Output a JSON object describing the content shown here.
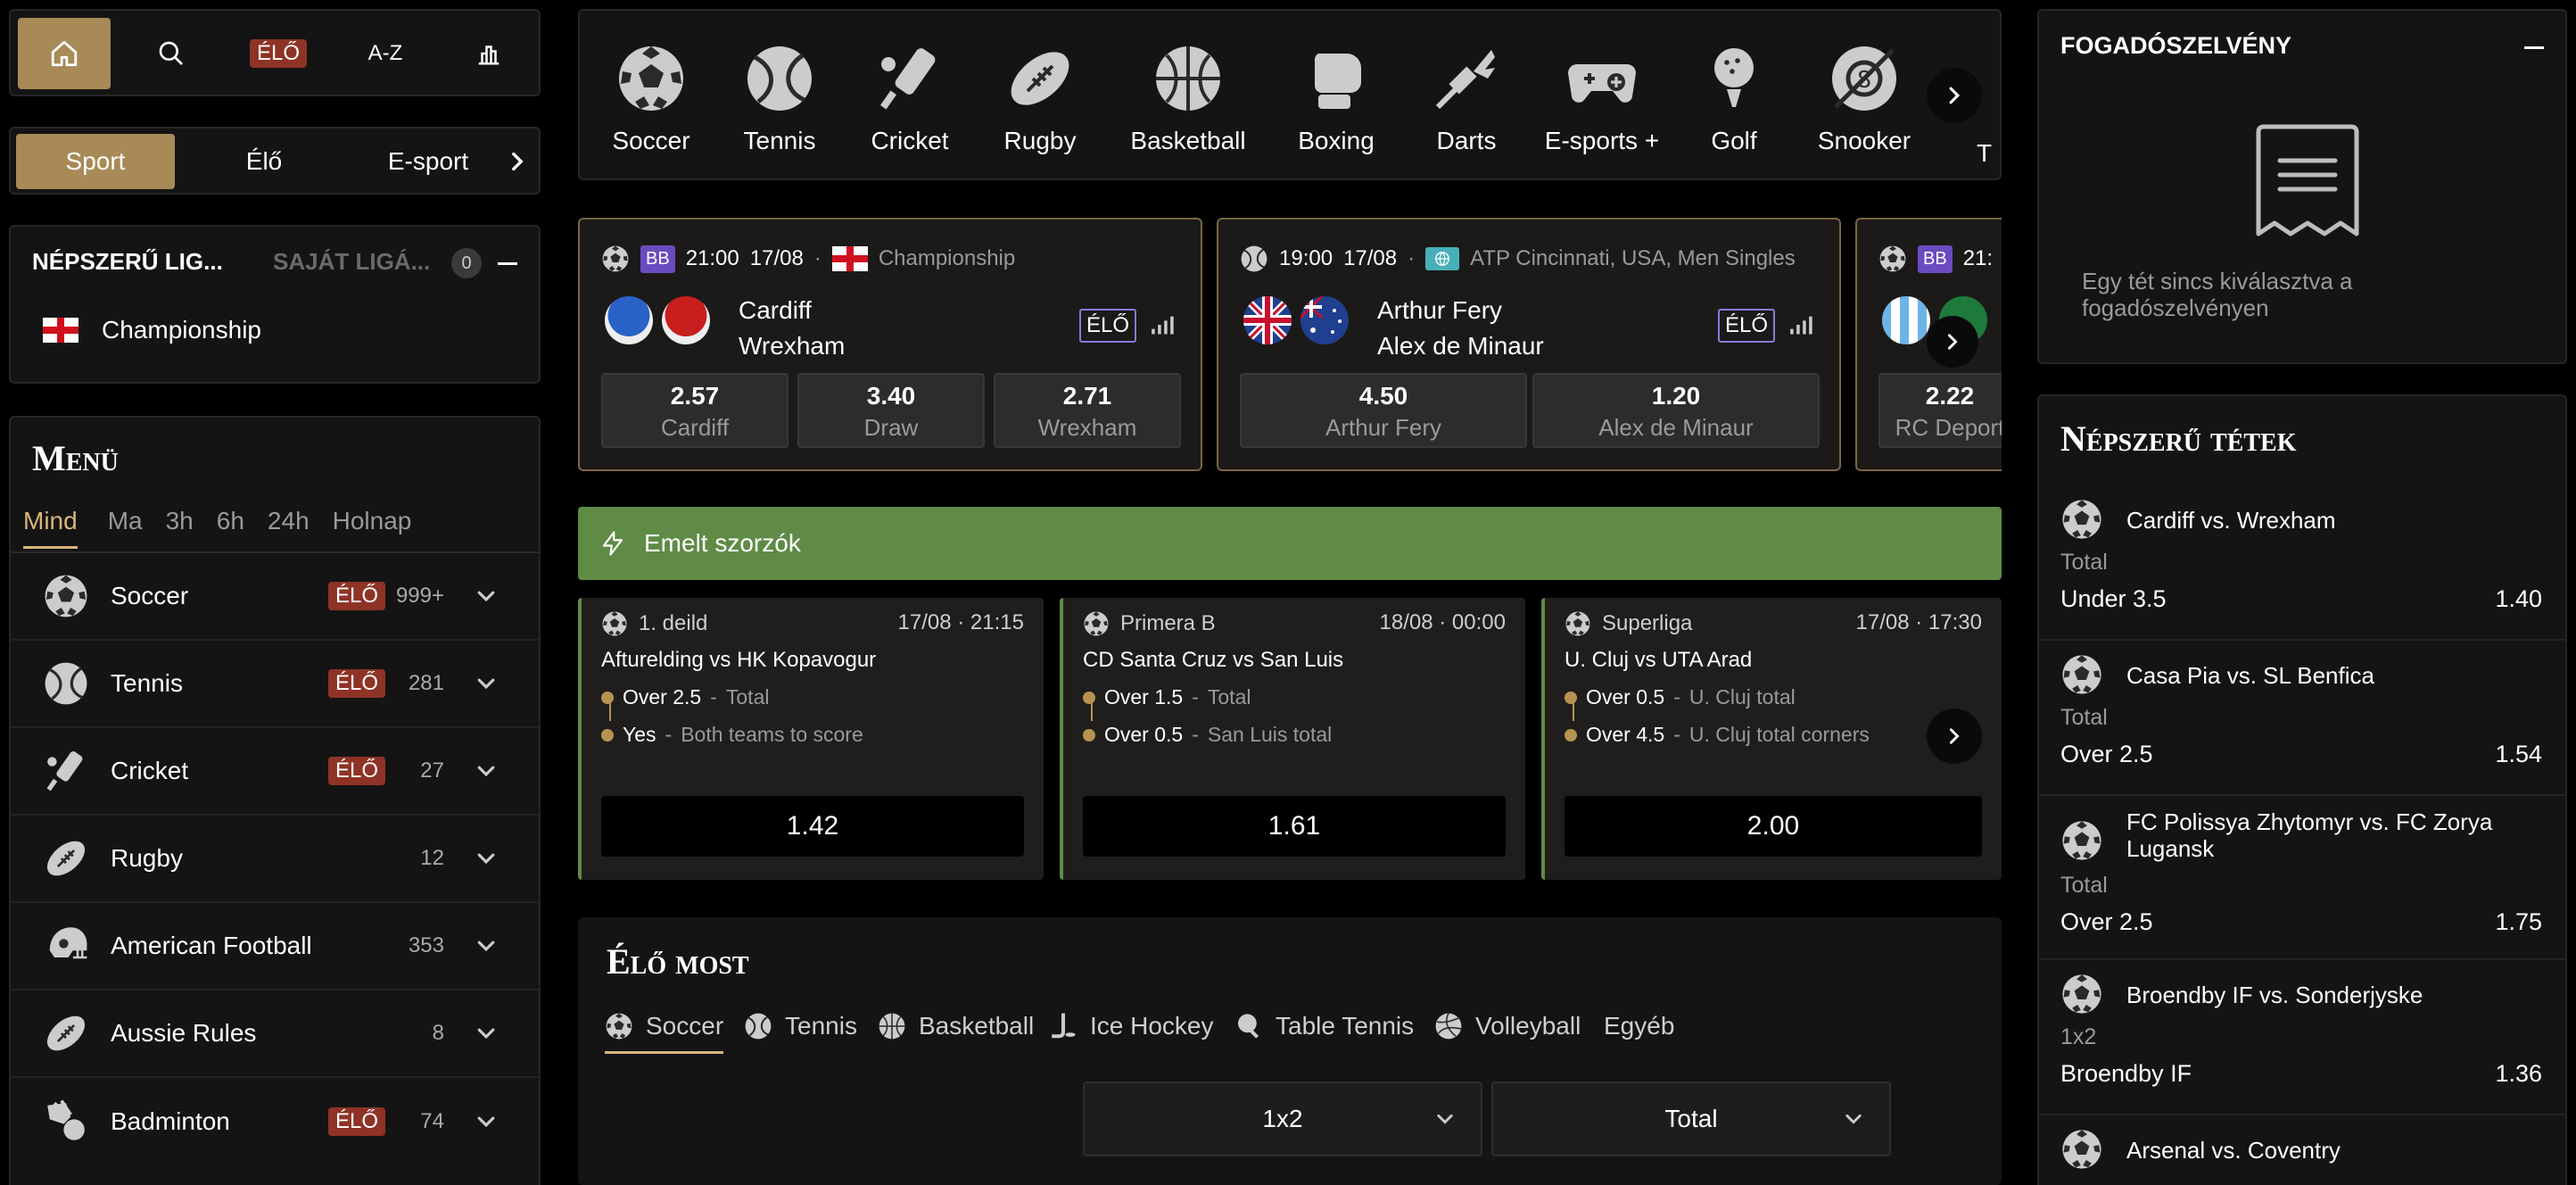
{
  "topnav": {
    "items": [
      {
        "icon": "home-icon"
      },
      {
        "icon": "search-icon"
      },
      {
        "label": "ÉLŐ"
      },
      {
        "label": "A-Z"
      },
      {
        "icon": "bar-chart-icon"
      }
    ]
  },
  "sportswitch": {
    "items": [
      "Sport",
      "Élő",
      "E-sport"
    ]
  },
  "leagues": {
    "tab_popular": "NÉPSZERŰ LIG...",
    "tab_own": "SAJÁT LIGÁ...",
    "own_count": "0",
    "items": [
      "Championship"
    ]
  },
  "menu": {
    "title": "Menü",
    "filters": [
      "Mind",
      "Ma",
      "3h",
      "6h",
      "24h",
      "Holnap"
    ],
    "live_label": "ÉLŐ",
    "items": [
      {
        "label": "Soccer",
        "live": true,
        "count": "999+"
      },
      {
        "label": "Tennis",
        "live": true,
        "count": "281"
      },
      {
        "label": "Cricket",
        "live": true,
        "count": "27"
      },
      {
        "label": "Rugby",
        "live": false,
        "count": "12"
      },
      {
        "label": "American Football",
        "live": false,
        "count": "353"
      },
      {
        "label": "Aussie Rules",
        "live": false,
        "count": "8"
      },
      {
        "label": "Badminton",
        "live": true,
        "count": "74"
      }
    ]
  },
  "sportbar": {
    "items": [
      "Soccer",
      "Tennis",
      "Cricket",
      "Rugby",
      "Basketball",
      "Boxing",
      "Darts",
      "E-sports +",
      "Golf",
      "Snooker",
      "T"
    ]
  },
  "matches": [
    {
      "bb": "BB",
      "time": "21:00",
      "date": "17/08",
      "league": "Championship",
      "home": "Cardiff",
      "away": "Wrexham",
      "live": "ÉLŐ",
      "odds": [
        {
          "v": "2.57",
          "n": "Cardiff"
        },
        {
          "v": "3.40",
          "n": "Draw"
        },
        {
          "v": "2.71",
          "n": "Wrexham"
        }
      ]
    },
    {
      "time": "19:00",
      "date": "17/08",
      "league": "ATP Cincinnati, USA, Men Singles",
      "home": "Arthur Fery",
      "away": "Alex de Minaur",
      "live": "ÉLŐ",
      "odds": [
        {
          "v": "4.50",
          "n": "Arthur Fery"
        },
        {
          "v": "1.20",
          "n": "Alex de Minaur"
        }
      ]
    },
    {
      "bb": "BB",
      "time": "21:",
      "odds": [
        {
          "v": "2.22",
          "n": "RC Deport"
        }
      ]
    }
  ],
  "boost": {
    "title": "Emelt szorzók"
  },
  "boosted": [
    {
      "league": "1. deild",
      "when": "17/08 · 21:15",
      "title": "Afturelding vs HK Kopavogur",
      "sel1": "Over 2.5",
      "mkt1": "Total",
      "sel2": "Yes",
      "mkt2": "Both teams to score",
      "odd": "1.42"
    },
    {
      "league": "Primera B",
      "when": "18/08 · 00:00",
      "title": "CD Santa Cruz vs San Luis",
      "sel1": "Over 1.5",
      "mkt1": "Total",
      "sel2": "Over 0.5",
      "mkt2": "San Luis total",
      "odd": "1.61"
    },
    {
      "league": "Superliga",
      "when": "17/08 · 17:30",
      "title": "U. Cluj vs UTA Arad",
      "sel1": "Over 0.5",
      "mkt1": "U. Cluj total",
      "sel2": "Over 4.5",
      "mkt2": "U. Cluj total corners",
      "odd": "2.00"
    }
  ],
  "live": {
    "title": "Élő most",
    "tabs": [
      "Soccer",
      "Tennis",
      "Basketball",
      "Ice Hockey",
      "Table Tennis",
      "Volleyball",
      "Egyéb"
    ],
    "dropdown1": "1x2",
    "dropdown2": "Total"
  },
  "betslip": {
    "title": "FOGADÓSZELVÉNY",
    "empty": "Egy tét sincs kiválasztva a fogadószelvényen"
  },
  "popular": {
    "title": "Népszerű tétek",
    "items": [
      {
        "match": "Cardiff vs. Wrexham",
        "market": "Total",
        "pick": "Under 3.5",
        "odd": "1.40"
      },
      {
        "match": "Casa Pia vs. SL Benfica",
        "market": "Total",
        "pick": "Over 2.5",
        "odd": "1.54"
      },
      {
        "match": "FC Polissya Zhytomyr vs. FC Zorya Lugansk",
        "market": "Total",
        "pick": "Over 2.5",
        "odd": "1.75"
      },
      {
        "match": "Broendby IF vs. Sonderjyske",
        "market": "1x2",
        "pick": "Broendby IF",
        "odd": "1.36"
      },
      {
        "match": "Arsenal vs. Coventry",
        "market": "",
        "pick": "",
        "odd": ""
      }
    ]
  },
  "colors": {
    "accent": "#d9b779",
    "gold_btn": "#a88a56",
    "live_red": "#8e3326",
    "boost_green": "#5f8b46"
  }
}
